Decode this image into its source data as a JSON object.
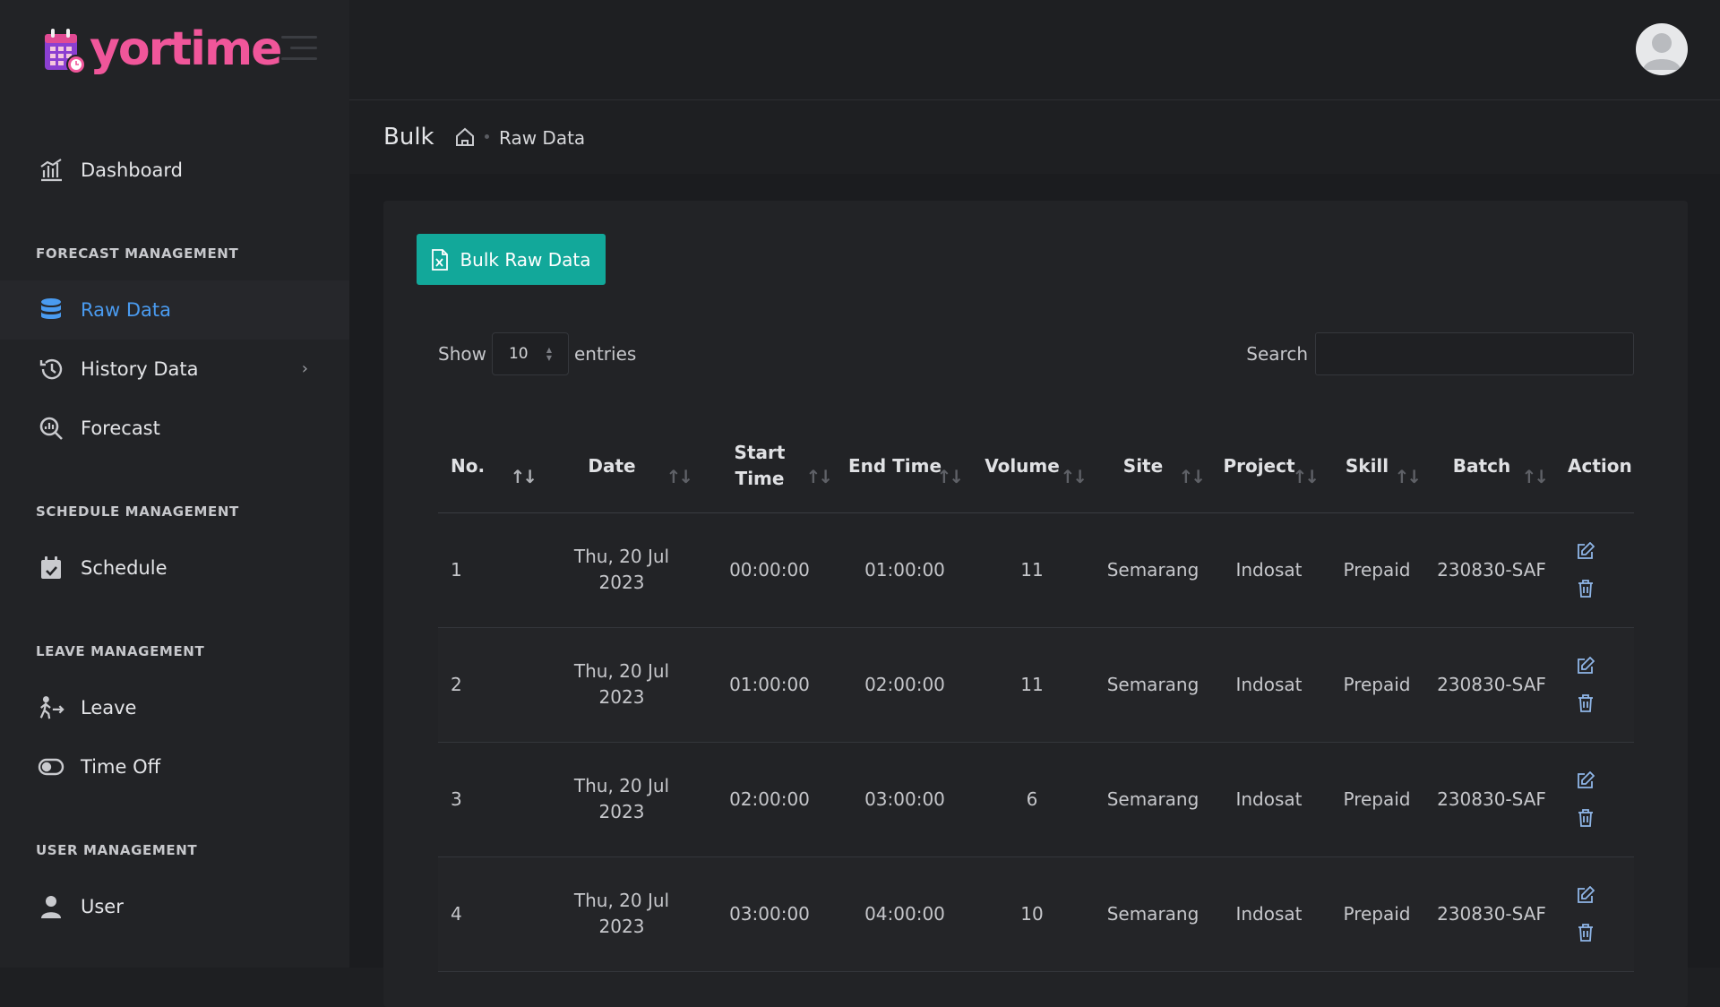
{
  "brand": {
    "name": "yortime",
    "accent": "#f0569a"
  },
  "sidebar": {
    "dashboard": {
      "label": "Dashboard",
      "icon": "chart-bar-icon"
    },
    "sections": [
      {
        "label": "FORECAST MANAGEMENT"
      },
      {
        "label": "SCHEDULE MANAGEMENT"
      },
      {
        "label": "LEAVE MANAGEMENT"
      },
      {
        "label": "USER MANAGEMENT"
      }
    ],
    "items": [
      {
        "label": "Raw Data",
        "icon": "database-icon",
        "active": true
      },
      {
        "label": "History Data",
        "icon": "history-icon"
      },
      {
        "label": "Forecast",
        "icon": "search-chart-icon"
      },
      {
        "label": "Schedule",
        "icon": "calendar-check-icon"
      },
      {
        "label": "Leave",
        "icon": "person-walking-arrow-icon"
      },
      {
        "label": "Time Off",
        "icon": "toggle-icon"
      },
      {
        "label": "User",
        "icon": "user-icon"
      }
    ],
    "active_color": "#4a9bf0"
  },
  "header": {
    "page_title": "Bulk",
    "breadcrumb_current": "Raw Data"
  },
  "toolbar": {
    "bulk_button_label": "Bulk Raw Data",
    "bulk_button_color": "#12a89a"
  },
  "table_controls": {
    "show_label": "Show",
    "page_size": "10",
    "entries_label": "entries",
    "search_label": "Search",
    "search_value": ""
  },
  "table": {
    "columns": [
      "No.",
      "Date",
      "Start Time",
      "End Time",
      "Volume",
      "Site",
      "Project",
      "Skill",
      "Batch",
      "Action"
    ],
    "rows": [
      {
        "no": "1",
        "date": "Thu, 20 Jul 2023",
        "start": "00:00:00",
        "end": "01:00:00",
        "volume": "11",
        "site": "Semarang",
        "project": "Indosat",
        "skill": "Prepaid",
        "batch": "230830-SAF"
      },
      {
        "no": "2",
        "date": "Thu, 20 Jul 2023",
        "start": "01:00:00",
        "end": "02:00:00",
        "volume": "11",
        "site": "Semarang",
        "project": "Indosat",
        "skill": "Prepaid",
        "batch": "230830-SAF"
      },
      {
        "no": "3",
        "date": "Thu, 20 Jul 2023",
        "start": "02:00:00",
        "end": "03:00:00",
        "volume": "6",
        "site": "Semarang",
        "project": "Indosat",
        "skill": "Prepaid",
        "batch": "230830-SAF"
      },
      {
        "no": "4",
        "date": "Thu, 20 Jul 2023",
        "start": "03:00:00",
        "end": "04:00:00",
        "volume": "10",
        "site": "Semarang",
        "project": "Indosat",
        "skill": "Prepaid",
        "batch": "230830-SAF"
      }
    ]
  }
}
